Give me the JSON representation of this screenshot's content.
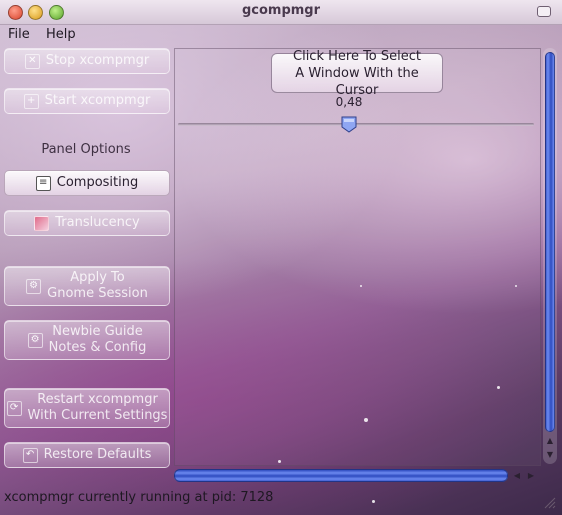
{
  "window": {
    "title": "gcompmgr"
  },
  "menu": {
    "file": "File",
    "help": "Help"
  },
  "sidebar": {
    "stop_label": "Stop xcompmgr",
    "start_label": "Start xcompmgr",
    "panel_options_label": "Panel Options",
    "compositing_label": "Compositing",
    "translucency_label": "Translucency",
    "apply_label": "Apply To\nGnome Session",
    "newbie_label": "Newbie Guide\nNotes & Config",
    "restart_label": "Restart xcompmgr\nWith Current Settings",
    "restore_label": "Restore Defaults"
  },
  "main": {
    "select_window_label": "Click Here To Select\nA Window With the Cursor",
    "opacity_value": "0,48",
    "opacity_fraction": 0.48
  },
  "status": {
    "text": "xcompmgr currently running at pid: 7128"
  },
  "icons": {
    "stop": "close-icon",
    "start": "plus-icon",
    "compositing": "document-icon",
    "translucency": "translucency-icon",
    "apply": "gear-icon",
    "newbie": "gear-icon",
    "restart": "refresh-icon",
    "restore": "undo-icon"
  },
  "colors": {
    "scrollbar_accent": "#3b5bd6"
  }
}
